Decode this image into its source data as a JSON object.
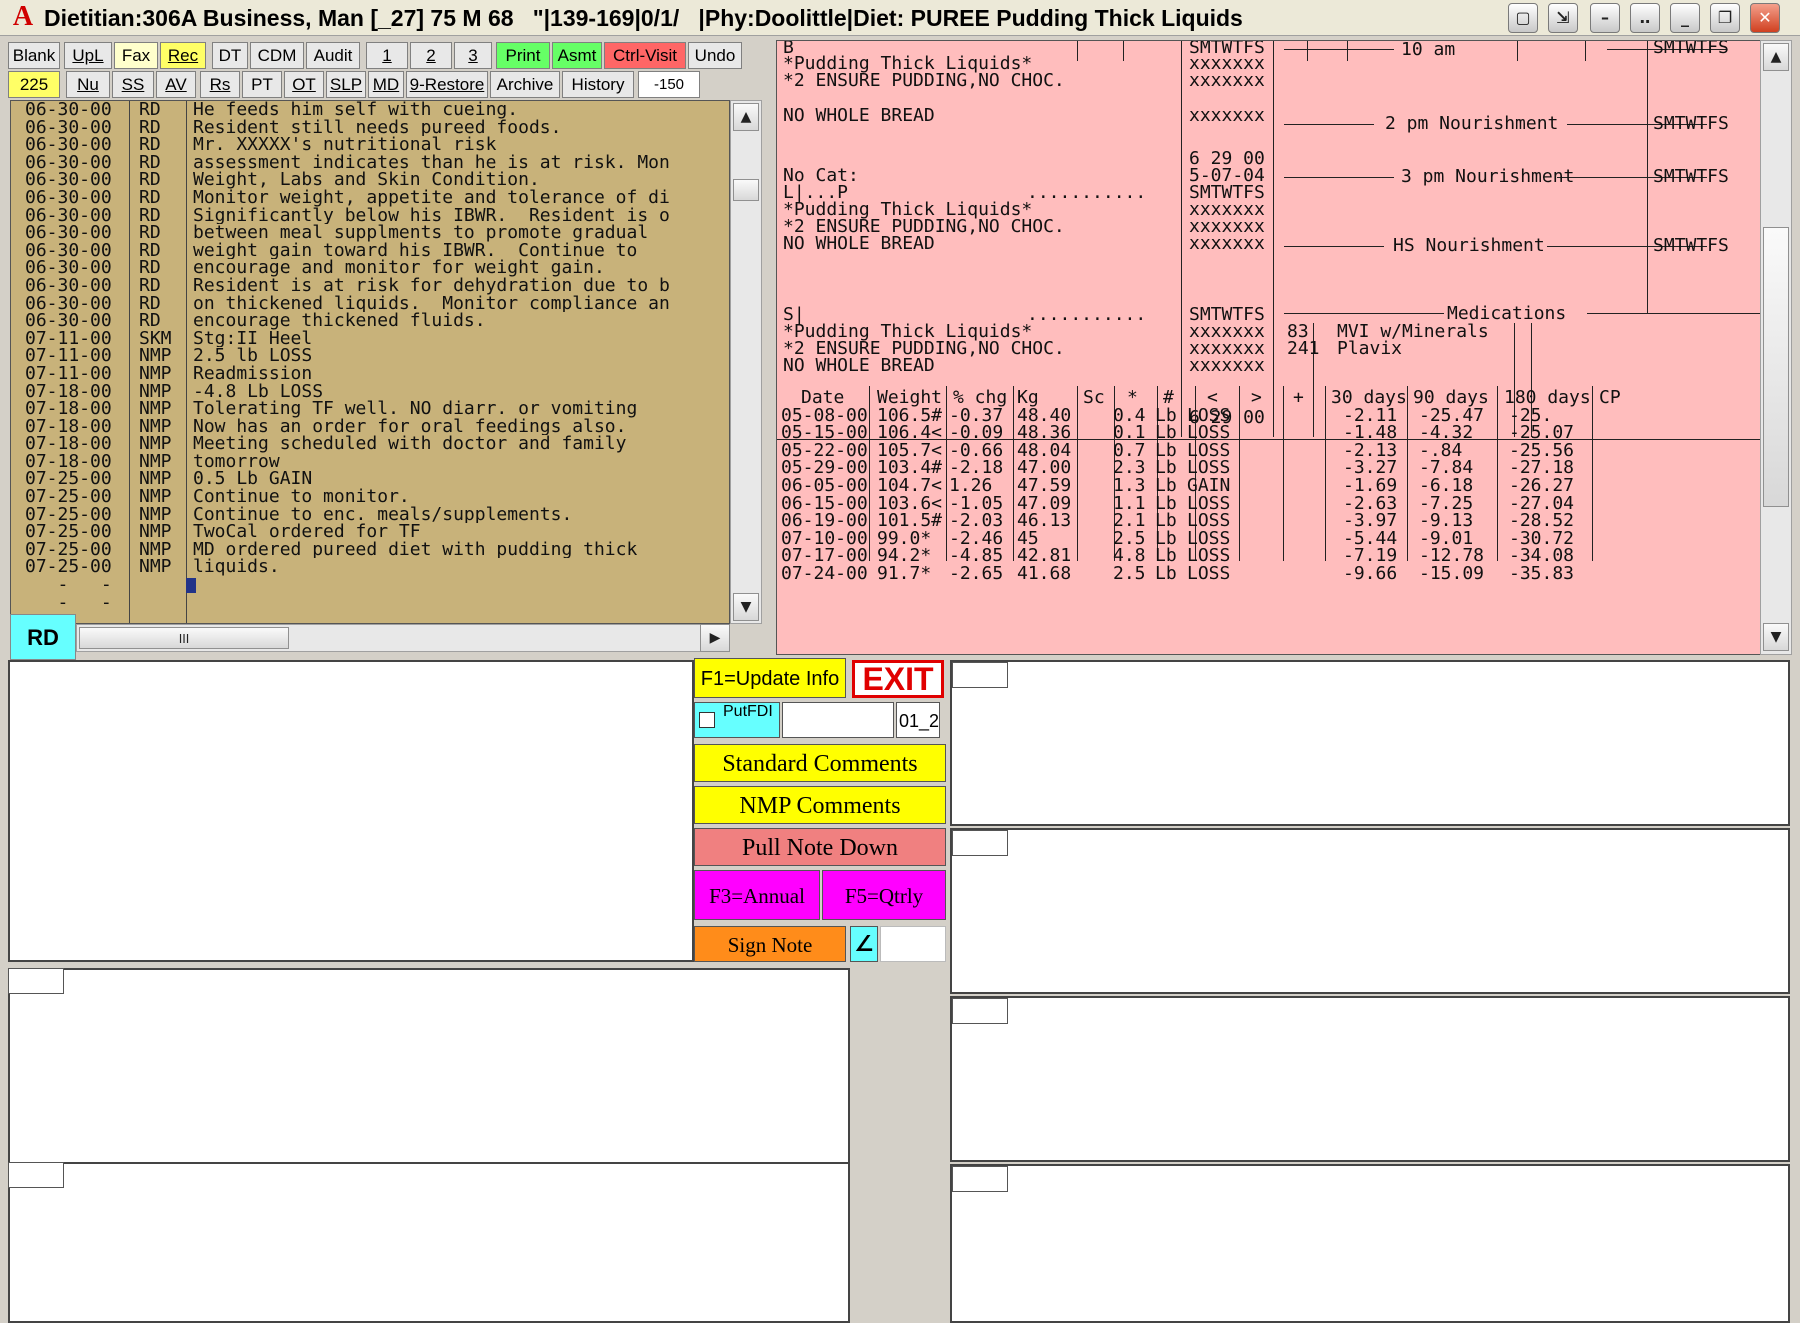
{
  "window": {
    "title": "Dietitian:306A Business, Man [_27] 75 M 68   \"|139-169|0/1/   |Phy:Doolittle|Diet: PUREE Pudding Thick Liquids",
    "logo": "A",
    "controls": [
      "▢",
      "⇲",
      "–",
      "‥",
      "_",
      "❐",
      "✕"
    ]
  },
  "toolbar1": [
    "Blank",
    "UpL",
    "Fax",
    "Rec",
    "DT",
    "CDM",
    "Audit",
    "1",
    "2",
    "3",
    "Print",
    "Asmt",
    "Ctrl-Visit",
    "Undo"
  ],
  "toolbar2": [
    "225",
    "Nu",
    "SS",
    "AV",
    "Rs",
    "PT",
    "OT",
    "SLP",
    "MD",
    "9-Restore",
    "Archive",
    "History",
    "-150"
  ],
  "notes": [
    {
      "date": "06-30-00",
      "code": "RD",
      "text": "He feeds him self with cueing."
    },
    {
      "date": "06-30-00",
      "code": "RD",
      "text": "Resident still needs pureed foods."
    },
    {
      "date": "06-30-00",
      "code": "RD",
      "text": "Mr. XXXXX's nutritional risk"
    },
    {
      "date": "06-30-00",
      "code": "RD",
      "text": "assessment indicates than he is at risk. Mon"
    },
    {
      "date": "06-30-00",
      "code": "RD",
      "text": "Weight, Labs and Skin Condition."
    },
    {
      "date": "06-30-00",
      "code": "RD",
      "text": "Monitor weight, appetite and tolerance of di"
    },
    {
      "date": "06-30-00",
      "code": "RD",
      "text": "Significantly below his IBWR.  Resident is o"
    },
    {
      "date": "06-30-00",
      "code": "RD",
      "text": "between meal supplments to promote gradual"
    },
    {
      "date": "06-30-00",
      "code": "RD",
      "text": "weight gain toward his IBWR.  Continue to"
    },
    {
      "date": "06-30-00",
      "code": "RD",
      "text": "encourage and monitor for weight gain."
    },
    {
      "date": "06-30-00",
      "code": "RD",
      "text": "Resident is at risk for dehydration due to b"
    },
    {
      "date": "06-30-00",
      "code": "RD",
      "text": "on thickened liquids.  Monitor compliance an"
    },
    {
      "date": "06-30-00",
      "code": "RD",
      "text": "encourage thickened fluids."
    },
    {
      "date": "07-11-00",
      "code": "SKM",
      "text": "Stg:II Heel"
    },
    {
      "date": "07-11-00",
      "code": "NMP",
      "text": "2.5 lb LOSS"
    },
    {
      "date": "07-11-00",
      "code": "NMP",
      "text": "Readmission"
    },
    {
      "date": "07-18-00",
      "code": "NMP",
      "text": "-4.8 Lb LOSS"
    },
    {
      "date": "07-18-00",
      "code": "NMP",
      "text": "Tolerating TF well. NO diarr. or vomiting"
    },
    {
      "date": "07-18-00",
      "code": "NMP",
      "text": "Now has an order for oral feedings also."
    },
    {
      "date": "07-18-00",
      "code": "NMP",
      "text": "Meeting scheduled with doctor and family"
    },
    {
      "date": "07-18-00",
      "code": "NMP",
      "text": "tomorrow"
    },
    {
      "date": "07-25-00",
      "code": "NMP",
      "text": "0.5 Lb GAIN"
    },
    {
      "date": "07-25-00",
      "code": "NMP",
      "text": "Continue to monitor."
    },
    {
      "date": "07-25-00",
      "code": "NMP",
      "text": "Continue to enc. meals/supplements."
    },
    {
      "date": "07-25-00",
      "code": "NMP",
      "text": "TwoCal ordered for TF"
    },
    {
      "date": "07-25-00",
      "code": "NMP",
      "text": "MD ordered pureed diet with pudding thick"
    },
    {
      "date": "07-25-00",
      "code": "NMP",
      "text": "liquids."
    },
    {
      "date": "   -   -",
      "code": "",
      "text": ""
    },
    {
      "date": "   -   -",
      "code": "",
      "text": ""
    }
  ],
  "rd_label": "RD",
  "hscroll_grip": "III",
  "meals": {
    "b_label": "B",
    "l_label": "L|...P",
    "s_label": "S|",
    "nocat": "No Cat:",
    "diet": "*Pudding Thick Liquids*",
    "ensure": "*2 ENSURE PUDDING,NO CHOC.",
    "nowhole": "NO WHOLE BREAD",
    "dots": "...........",
    "smtwtfs": "SMTWTFS",
    "x": "xxxxxxx",
    "date1": "6 29 00",
    "date2": "5-07-04",
    "date3": "6 29 00"
  },
  "nourishment": {
    "am10": "10 am",
    "pm2": "2 pm Nourishment",
    "pm3": "3 pm Nourishment",
    "hs": "HS Nourishment",
    "medications": "Medications"
  },
  "meds": [
    {
      "code": "83",
      "name": "MVI w/Minerals"
    },
    {
      "code": "241",
      "name": "Plavix"
    }
  ],
  "weights": {
    "headers": [
      "Date",
      "Weight",
      "% chg",
      "Kg",
      "Sc",
      "*",
      "#",
      "<",
      ">",
      "+",
      "30 days",
      "90 days",
      "180 days",
      "CP"
    ],
    "rows": [
      {
        "date": "05-08-00",
        "weight": "106.5#",
        "chg": "-0.37",
        "kg": "48.40",
        "lb": "0.4",
        "dir": "LOSS",
        "d30": "-2.11",
        "d90": "-25.47",
        "d180": "-25."
      },
      {
        "date": "05-15-00",
        "weight": "106.4<",
        "chg": "-0.09",
        "kg": "48.36",
        "lb": "0.1",
        "dir": "LOSS",
        "d30": "-1.48",
        "d90": "-4.32",
        "d180": "-25.07"
      },
      {
        "date": "05-22-00",
        "weight": "105.7<",
        "chg": "-0.66",
        "kg": "48.04",
        "lb": "0.7",
        "dir": "LOSS",
        "d30": "-2.13",
        "d90": "-.84",
        "d180": "-25.56"
      },
      {
        "date": "05-29-00",
        "weight": "103.4#",
        "chg": "-2.18",
        "kg": "47.00",
        "lb": "2.3",
        "dir": "LOSS",
        "d30": "-3.27",
        "d90": "-7.84",
        "d180": "-27.18"
      },
      {
        "date": "06-05-00",
        "weight": "104.7<",
        "chg": "1.26",
        "kg": "47.59",
        "lb": "1.3",
        "dir": "GAIN",
        "d30": "-1.69",
        "d90": "-6.18",
        "d180": "-26.27"
      },
      {
        "date": "06-15-00",
        "weight": "103.6<",
        "chg": "-1.05",
        "kg": "47.09",
        "lb": "1.1",
        "dir": "LOSS",
        "d30": "-2.63",
        "d90": "-7.25",
        "d180": "-27.04"
      },
      {
        "date": "06-19-00",
        "weight": "101.5#",
        "chg": "-2.03",
        "kg": "46.13",
        "lb": "2.1",
        "dir": "LOSS",
        "d30": "-3.97",
        "d90": "-9.13",
        "d180": "-28.52"
      },
      {
        "date": "07-10-00",
        "weight": "99.0*",
        "chg": "-2.46",
        "kg": "45",
        "lb": "2.5",
        "dir": "LOSS",
        "d30": "-5.44",
        "d90": "-9.01",
        "d180": "-30.72"
      },
      {
        "date": "07-17-00",
        "weight": "94.2*",
        "chg": "-4.85",
        "kg": "42.81",
        "lb": "4.8",
        "dir": "LOSS",
        "d30": "-7.19",
        "d90": "-12.78",
        "d180": "-34.08"
      },
      {
        "date": "07-24-00",
        "weight": "91.7*",
        "chg": "-2.65",
        "kg": "41.68",
        "lb": "2.5",
        "dir": "LOSS",
        "d30": "-9.66",
        "d90": "-15.09",
        "d180": "-35.83"
      }
    ],
    "lb_unit": "Lb"
  },
  "actions": {
    "f1": "F1=Update Info",
    "exit": "EXIT",
    "putfdi": "PutFDI",
    "putfdi_value": "",
    "code_value": "01_2",
    "standard": "Standard Comments",
    "nmp": "NMP Comments",
    "pull": "Pull Note Down",
    "f3": "F3=Annual",
    "f5": "F5=Qtrly",
    "sign": "Sign Note",
    "sign_icon": "∠",
    "sign_value": ""
  },
  "colors": {
    "notes_bg": "#c8b27a",
    "pink_bg": "#ffbdbd",
    "yellow": "#ffff00",
    "salmon": "#f08080",
    "magenta": "#ff00ff",
    "orange": "#ff8c1a",
    "cyan": "#66ffff"
  }
}
